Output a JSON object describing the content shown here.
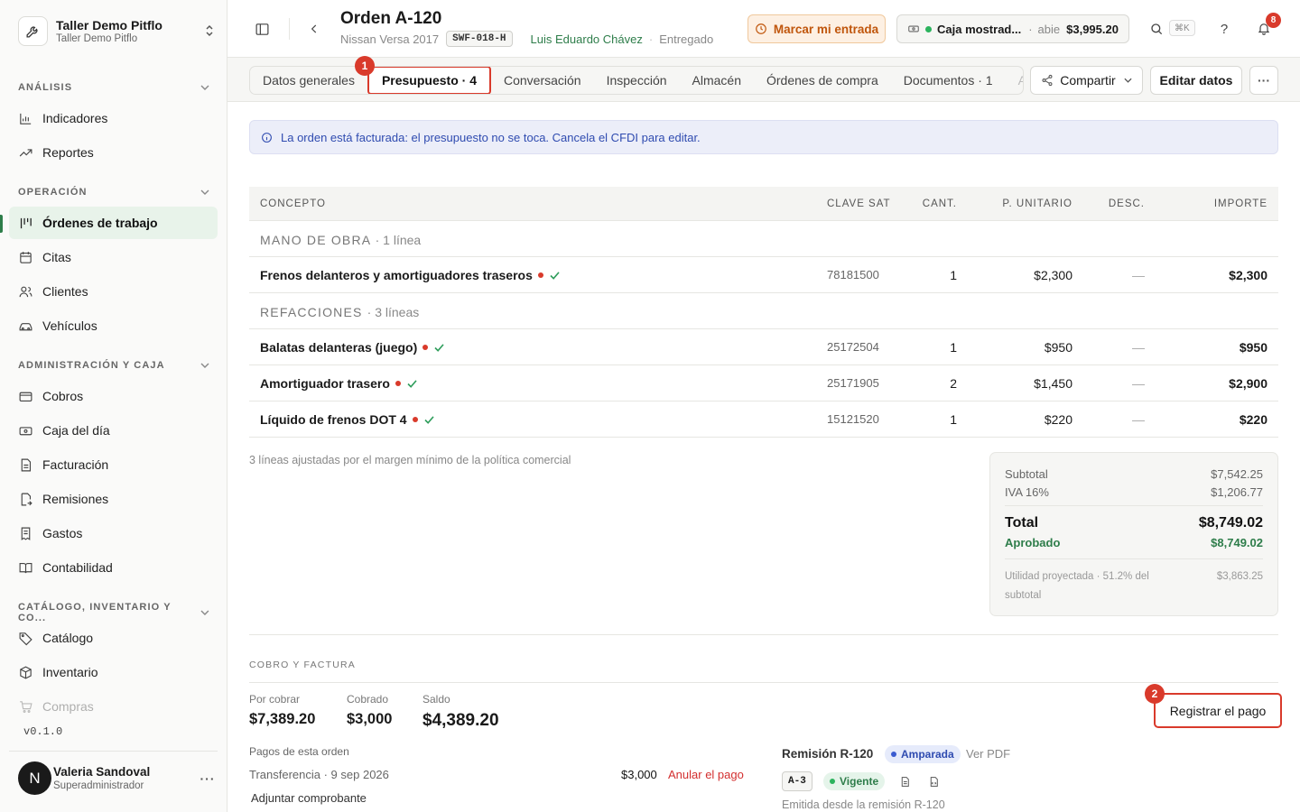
{
  "workspace": {
    "name": "Taller Demo Pitflo",
    "sub": "Taller Demo Pitflo"
  },
  "sidebar": {
    "sections": [
      {
        "label": "ANÁLISIS",
        "items": [
          "Indicadores",
          "Reportes"
        ]
      },
      {
        "label": "OPERACIÓN",
        "items": [
          "Órdenes de trabajo",
          "Citas",
          "Clientes",
          "Vehículos"
        ]
      },
      {
        "label": "ADMINISTRACIÓN Y CAJA",
        "items": [
          "Cobros",
          "Caja del día",
          "Facturación",
          "Remisiones",
          "Gastos",
          "Contabilidad"
        ]
      },
      {
        "label": "CATÁLOGO, INVENTARIO Y CO...",
        "items": [
          "Catálogo",
          "Inventario",
          "Compras"
        ]
      }
    ],
    "active_item": "Órdenes de trabajo",
    "version": "v0.1.0"
  },
  "user": {
    "initial": "N",
    "name": "Valeria Sandoval",
    "role": "Superadministrador"
  },
  "header": {
    "title": "Orden A-120",
    "vehicle": "Nissan Versa 2017",
    "plate": "SWF-018-H",
    "customer": "Luis Eduardo Chávez",
    "status": "Entregado",
    "checkin_label": "Marcar mi entrada",
    "caja": {
      "name": "Caja mostrad...",
      "state": "abie",
      "amount": "$3,995.20"
    },
    "shortcut": "⌘K",
    "notifications": "8"
  },
  "tabs": [
    "Datos generales",
    "Presupuesto · 4",
    "Conversación",
    "Inspección",
    "Almacén",
    "Órdenes de compra",
    "Documentos · 1",
    "Ad"
  ],
  "actions": {
    "share": "Compartir",
    "edit": "Editar datos"
  },
  "markers": {
    "one": "1",
    "two": "2"
  },
  "alert": "La orden está facturada: el presupuesto no se toca. Cancela el CFDI para editar.",
  "table": {
    "headers": {
      "concept": "CONCEPTO",
      "sat": "CLAVE SAT",
      "qty": "CANT.",
      "unit": "P. UNITARIO",
      "disc": "DESC.",
      "amount": "IMPORTE"
    },
    "groups": [
      {
        "label": "MANO DE OBRA",
        "count": "· 1 línea",
        "rows": [
          {
            "name": "Frenos delanteros y amortiguadores traseros",
            "sat": "78181500",
            "qty": "1",
            "unit": "$2,300",
            "disc": "—",
            "amount": "$2,300"
          }
        ]
      },
      {
        "label": "REFACCIONES",
        "count": "· 3 líneas",
        "rows": [
          {
            "name": "Balatas delanteras (juego)",
            "sat": "25172504",
            "qty": "1",
            "unit": "$950",
            "disc": "—",
            "amount": "$950"
          },
          {
            "name": "Amortiguador trasero",
            "sat": "25171905",
            "qty": "2",
            "unit": "$1,450",
            "disc": "—",
            "amount": "$2,900"
          },
          {
            "name": "Líquido de frenos DOT 4",
            "sat": "15121520",
            "qty": "1",
            "unit": "$220",
            "disc": "—",
            "amount": "$220"
          }
        ]
      }
    ]
  },
  "note": "3 líneas ajustadas por el margen mínimo de la política comercial",
  "totals": {
    "subtotal_label": "Subtotal",
    "subtotal": "$7,542.25",
    "iva_label": "IVA 16%",
    "iva": "$1,206.77",
    "total_label": "Total",
    "total": "$8,749.02",
    "approved_label": "Aprobado",
    "approved": "$8,749.02",
    "util_label": "Utilidad proyectada · 51.2% del subtotal",
    "util": "$3,863.25"
  },
  "billing": {
    "section": "COBRO Y FACTURA",
    "por_cobrar_label": "Por cobrar",
    "por_cobrar": "$7,389.20",
    "cobrado_label": "Cobrado",
    "cobrado": "$3,000",
    "saldo_label": "Saldo",
    "saldo": "$4,389.20",
    "register": "Registrar el pago",
    "payments_label": "Pagos de esta orden",
    "payment": {
      "desc": "Transferencia · 9 sep 2026",
      "amount": "$3,000",
      "void": "Anular el pago"
    },
    "attach": "Adjuntar comprobante",
    "remision": {
      "title": "Remisión R-120",
      "badge": "Amparada",
      "pdf": "Ver PDF",
      "tag": "A-3",
      "status": "Vigente",
      "emitted": "Emitida desde la remisión R-120"
    }
  }
}
